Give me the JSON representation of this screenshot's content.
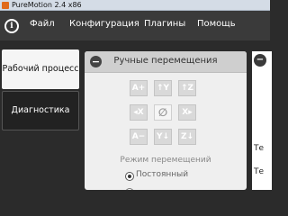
{
  "window": {
    "title": "PureMotion 2.4 x86"
  },
  "menu": {
    "items": [
      "Файл",
      "Конфигурация",
      "Плагины",
      "Помощь"
    ]
  },
  "tabs": [
    {
      "label": "Рабочий процесс",
      "active": true
    },
    {
      "label": "Диагностика",
      "active": false
    }
  ],
  "panel": {
    "title": "Ручные перемещения",
    "jog_buttons": [
      {
        "label": "A+",
        "name": "a-plus"
      },
      {
        "label": "↑Y",
        "name": "y-plus"
      },
      {
        "label": "↑Z",
        "name": "z-plus"
      },
      {
        "label": "◂X",
        "name": "x-minus"
      },
      {
        "label": "∅",
        "name": "center"
      },
      {
        "label": "X▸",
        "name": "x-plus"
      },
      {
        "label": "A−",
        "name": "a-minus"
      },
      {
        "label": "Y↓",
        "name": "y-minus"
      },
      {
        "label": "Z↓",
        "name": "z-minus"
      }
    ],
    "mode_label": "Режим перемещений",
    "mode_option": "Постоянный"
  },
  "right": {
    "text1": "Те",
    "text2": "Те"
  },
  "colors": {
    "accent": "#e06a1b",
    "menubar": "#3a3a3a",
    "background": "#2b2b2b"
  }
}
